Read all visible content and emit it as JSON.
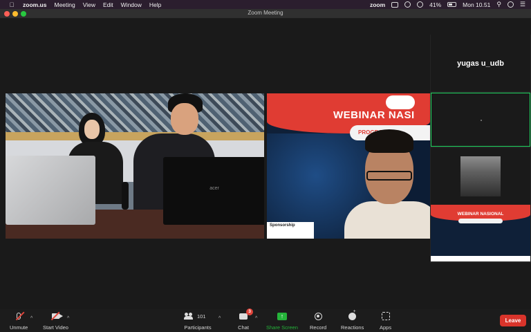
{
  "menubar": {
    "app_name": "zoom.us",
    "items": [
      "Meeting",
      "View",
      "Edit",
      "Window",
      "Help"
    ],
    "status_app": "zoom",
    "battery": "41%",
    "clock": "Mon 10.51"
  },
  "window": {
    "title": "Zoom Meeting"
  },
  "tile_presenter": {
    "banner_title": "WEBINAR NASI",
    "banner_subtitle": "PROGRAMMIN",
    "sponsor_label": "Sponsorship"
  },
  "tile_room": {
    "laptop_brand": "acer"
  },
  "participants": [
    {
      "name": "yugas u_udb"
    }
  ],
  "strip_share": {
    "title": "WEBINAR NASIONAL"
  },
  "toolbar": {
    "unmute": "Unmute",
    "start_video": "Start Video",
    "participants": "Participants",
    "participants_count": "101",
    "chat": "Chat",
    "chat_badge": "3",
    "share_screen": "Share Screen",
    "record": "Record",
    "reactions": "Reactions",
    "apps": "Apps",
    "leave": "Leave"
  },
  "colors": {
    "leave": "#d9342b",
    "share": "#25b43a",
    "active_speaker_border": "#1ed760",
    "banner_red": "#e03c33"
  }
}
